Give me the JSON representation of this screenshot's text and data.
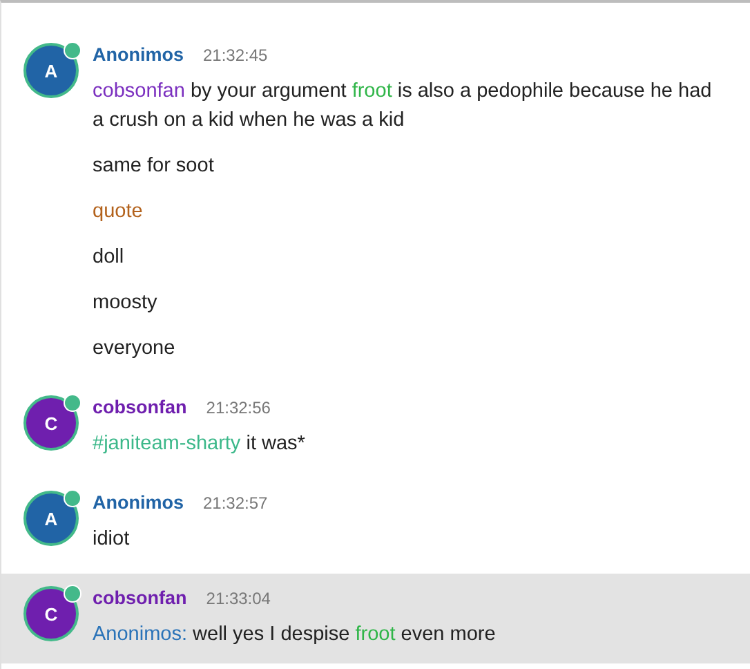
{
  "messages": [
    {
      "author": "Anonimos",
      "initial": "A",
      "color": "#2164a6",
      "online": true,
      "time": "21:32:45",
      "highlighted": false,
      "lines": [
        [
          {
            "kind": "mention",
            "text": "cobsonfan",
            "color": "#7b2fbf"
          },
          {
            "kind": "text",
            "text": " by your argument "
          },
          {
            "kind": "mention",
            "text": "froot",
            "color": "#2fb548"
          },
          {
            "kind": "text",
            "text": " is also a pedophile because he had a crush on a kid when he was a kid"
          }
        ],
        [
          {
            "kind": "text",
            "text": "same for soot"
          }
        ],
        [
          {
            "kind": "quote",
            "text": "quote"
          }
        ],
        [
          {
            "kind": "text",
            "text": "doll"
          }
        ],
        [
          {
            "kind": "text",
            "text": "moosty"
          }
        ],
        [
          {
            "kind": "text",
            "text": "everyone"
          }
        ]
      ]
    },
    {
      "author": "cobsonfan",
      "initial": "C",
      "color": "#6f1fae",
      "online": true,
      "time": "21:32:56",
      "highlighted": false,
      "lines": [
        [
          {
            "kind": "channel",
            "text": "#janiteam-sharty"
          },
          {
            "kind": "text",
            "text": " it was*"
          }
        ]
      ]
    },
    {
      "author": "Anonimos",
      "initial": "A",
      "color": "#2164a6",
      "online": true,
      "time": "21:32:57",
      "highlighted": false,
      "lines": [
        [
          {
            "kind": "text",
            "text": "idiot"
          }
        ]
      ]
    },
    {
      "author": "cobsonfan",
      "initial": "C",
      "color": "#6f1fae",
      "online": true,
      "time": "21:33:04",
      "highlighted": true,
      "lines": [
        [
          {
            "kind": "mention",
            "text": "Anonimos:",
            "color": "#2a73b8"
          },
          {
            "kind": "text",
            "text": " well yes I despise "
          },
          {
            "kind": "mention",
            "text": "froot",
            "color": "#2fb548"
          },
          {
            "kind": "text",
            "text": " even more"
          }
        ]
      ]
    }
  ]
}
